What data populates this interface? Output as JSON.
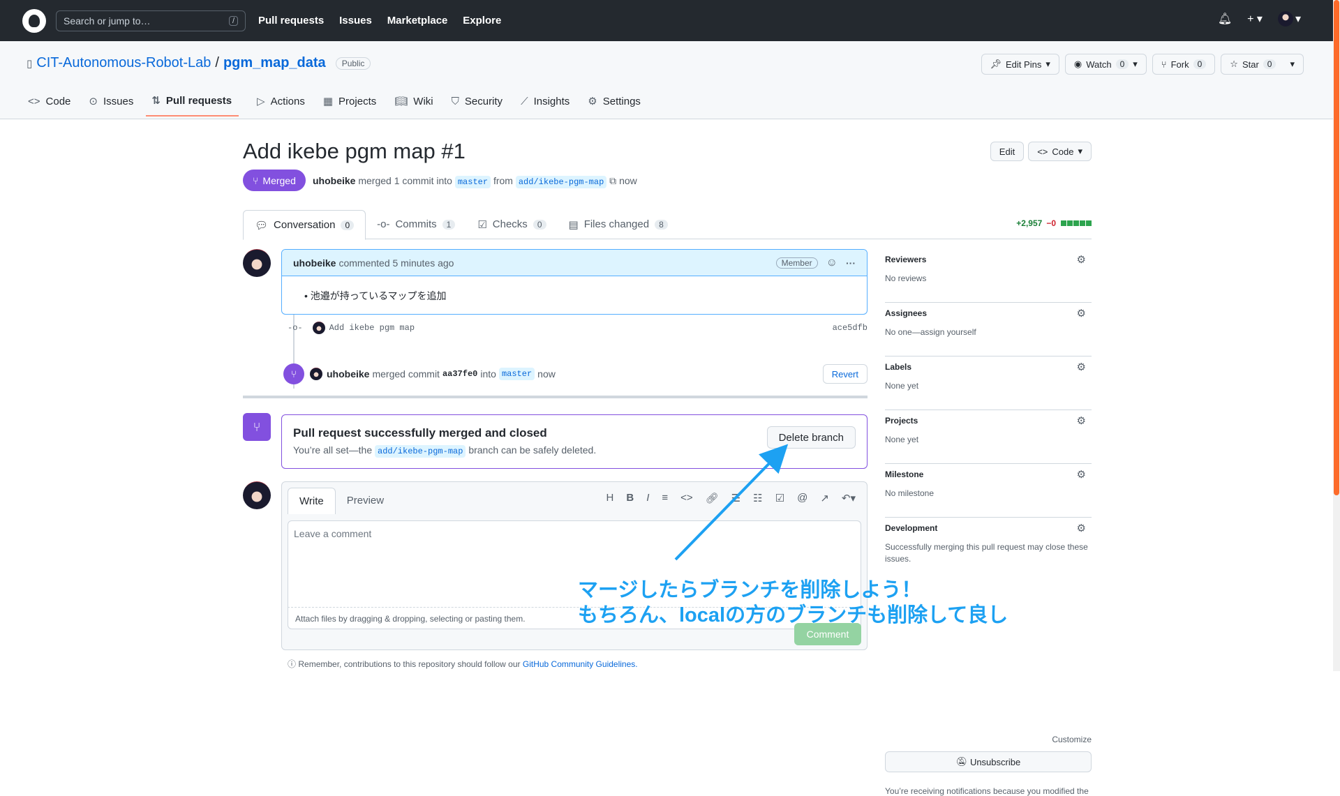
{
  "header": {
    "search_placeholder": "Search or jump to…",
    "search_key": "/",
    "nav": [
      "Pull requests",
      "Issues",
      "Marketplace",
      "Explore"
    ]
  },
  "repo": {
    "owner": "CIT-Autonomous-Robot-Lab",
    "separator": "/",
    "name": "pgm_map_data",
    "visibility": "Public",
    "buttons": {
      "edit_pins": "Edit Pins",
      "watch": "Watch",
      "watch_count": "0",
      "fork": "Fork",
      "fork_count": "0",
      "star": "Star",
      "star_count": "0"
    },
    "tabs": [
      {
        "label": "Code",
        "icon": "code-icon"
      },
      {
        "label": "Issues",
        "icon": "issue-icon"
      },
      {
        "label": "Pull requests",
        "icon": "pr-icon"
      },
      {
        "label": "Actions",
        "icon": "play-icon"
      },
      {
        "label": "Projects",
        "icon": "table-icon"
      },
      {
        "label": "Wiki",
        "icon": "book-icon"
      },
      {
        "label": "Security",
        "icon": "shield-icon"
      },
      {
        "label": "Insights",
        "icon": "graph-icon"
      },
      {
        "label": "Settings",
        "icon": "gear-icon"
      }
    ]
  },
  "pr": {
    "title": "Add ikebe pgm map #1",
    "state": "Merged",
    "author": "uhobeike",
    "merged_text": "merged 1 commit into",
    "base": "master",
    "from": "from",
    "head": "add/ikebe-pgm-map",
    "time": "now",
    "edit": "Edit",
    "code": "Code",
    "tabs": [
      {
        "label": "Conversation",
        "count": "0"
      },
      {
        "label": "Commits",
        "count": "1"
      },
      {
        "label": "Checks",
        "count": "0"
      },
      {
        "label": "Files changed",
        "count": "8"
      }
    ],
    "additions": "+2,957",
    "deletions": "−0"
  },
  "comment": {
    "author": "uhobeike",
    "meta": "commented 5 minutes ago",
    "role": "Member",
    "body": "池邉が持っているマップを追加"
  },
  "commit": {
    "message": "Add ikebe pgm map",
    "sha": "ace5dfb"
  },
  "merge_event": {
    "author": "uhobeike",
    "text1": "merged commit",
    "sha": "aa37fe0",
    "text2": "into",
    "branch": "master",
    "time": "now",
    "revert": "Revert"
  },
  "merge_box": {
    "title": "Pull request successfully merged and closed",
    "text1": "You’re all set—the",
    "branch": "add/ikebe-pgm-map",
    "text2": "branch can be safely deleted.",
    "delete": "Delete branch"
  },
  "editor": {
    "write": "Write",
    "preview": "Preview",
    "placeholder": "Leave a comment",
    "attach": "Attach files by dragging & dropping, selecting or pasting them.",
    "submit": "Comment"
  },
  "remember": {
    "text": "Remember, contributions to this repository should follow our",
    "link": "GitHub Community Guidelines."
  },
  "sidebar": [
    {
      "title": "Reviewers",
      "value": "No reviews"
    },
    {
      "title": "Assignees",
      "value": "No one—assign yourself"
    },
    {
      "title": "Labels",
      "value": "None yet"
    },
    {
      "title": "Projects",
      "value": "None yet"
    },
    {
      "title": "Milestone",
      "value": "No milestone"
    },
    {
      "title": "Development",
      "value": "Successfully merging this pull request may close these issues."
    }
  ],
  "notifications": {
    "customize": "Customize",
    "unsubscribe": "Unsubscribe",
    "note": "You’re receiving notifications because you modified the"
  },
  "annotation": {
    "line1": "マージしたらブランチを削除しよう！",
    "line2": "もちろん、localの方のブランチも削除して良し"
  },
  "colors": {
    "merged": "#8250df",
    "annotation": "#1da1f2",
    "link": "#0969da"
  }
}
